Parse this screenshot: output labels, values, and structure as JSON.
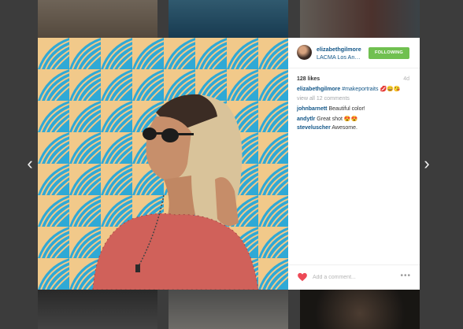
{
  "post": {
    "username": "elizabethgilmore",
    "location": "LACMA Los An…",
    "follow_label": "FOLLOWING",
    "likes": "128 likes",
    "time": "4d",
    "caption_user": "elizabethgilmore",
    "caption_tag": "#makeportraits",
    "caption_emoji": "💋😄😘",
    "view_all": "view all 12 comments",
    "comments": [
      {
        "user": "johnbarnett",
        "text": "Beautiful color!"
      },
      {
        "user": "andytlr",
        "text": "Great shot 😍😍"
      },
      {
        "user": "steveluscher",
        "text": "Awesome."
      }
    ],
    "add_comment_placeholder": "Add a comment..."
  },
  "nav": {
    "prev": "‹",
    "next": "›"
  },
  "icons": {
    "heart": "heart-icon",
    "more": "more-icon",
    "prev": "chevron-left-icon",
    "next": "chevron-right-icon"
  },
  "colors": {
    "accent_link": "#125688",
    "follow_green": "#70c050",
    "heart_red": "#ed4956"
  }
}
